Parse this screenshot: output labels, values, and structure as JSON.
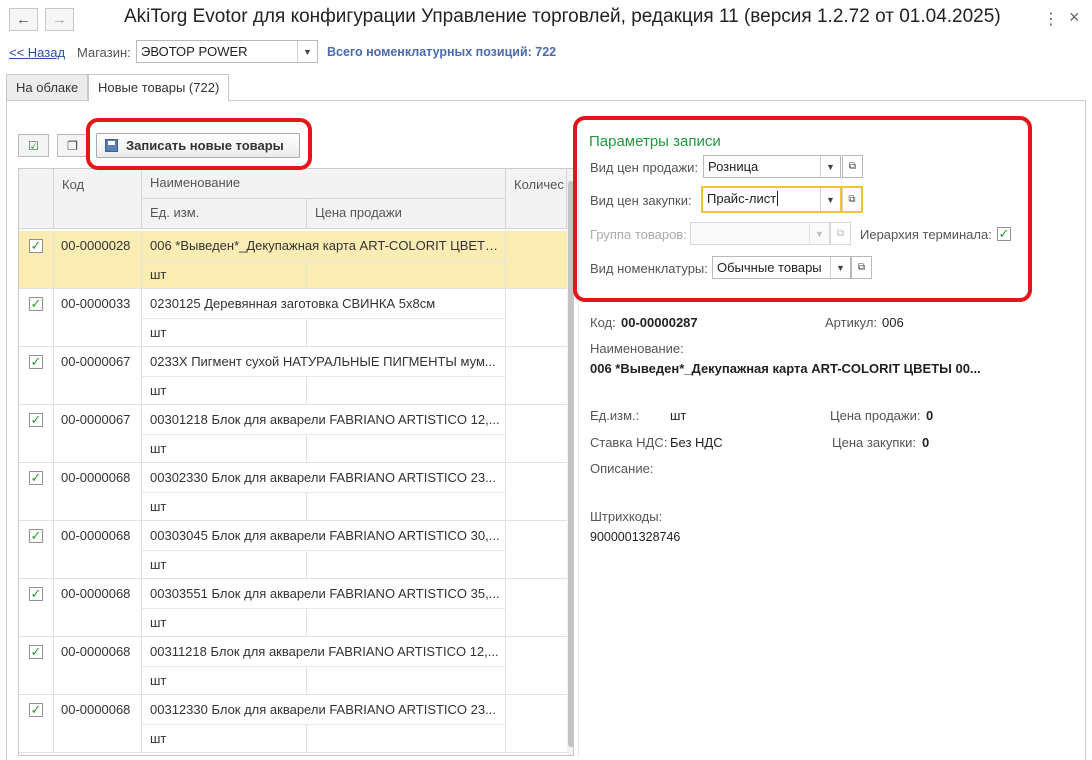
{
  "window": {
    "title": "AkiTorg Evotor для конфигурации Управление торговлей, редакция 11 (версия 1.2.72 от 01.04.2025)",
    "back_icon": "←",
    "forward_icon": "→",
    "menu_icon": "⋮",
    "close_icon": "×"
  },
  "topbar": {
    "back_link": "<< Назад",
    "store_label": "Магазин:",
    "store_value": "ЭВОТОР POWER",
    "total_text": "Всего номенклатурных позиций: 722"
  },
  "tabs": [
    {
      "label": "На облаке"
    },
    {
      "label": "Новые товары (722)"
    }
  ],
  "toolbar": {
    "save_new_label": "Записать новые товары"
  },
  "grid": {
    "columns": {
      "code": "Код",
      "name": "Наименование",
      "unit": "Ед. изм.",
      "price": "Цена продажи",
      "qty": "Количес"
    },
    "rows": [
      {
        "checked": "✓",
        "code": "00-0000028",
        "name": "006 *Выведен*_Декупажная карта ART-COLORIT ЦВЕТЫ 00...",
        "unit": "шт"
      },
      {
        "checked": "✓",
        "code": "00-0000033",
        "name": "0230125 Деревянная заготовка СВИНКА 5х8см",
        "unit": "шт"
      },
      {
        "checked": "✓",
        "code": "00-0000067",
        "name": "0233Х Пигмент сухой НАТУРАЛЬНЫЕ ПИГМЕНТЫ мум...",
        "unit": "шт"
      },
      {
        "checked": "✓",
        "code": "00-0000067",
        "name": "00301218 Блок для акварели FABRIANO ARTISTICO 12,...",
        "unit": "шт"
      },
      {
        "checked": "✓",
        "code": "00-0000068",
        "name": "00302330 Блок для акварели FABRIANO ARTISTICO 23...",
        "unit": "шт"
      },
      {
        "checked": "✓",
        "code": "00-0000068",
        "name": "00303045 Блок для акварели FABRIANO ARTISTICO 30,...",
        "unit": "шт"
      },
      {
        "checked": "✓",
        "code": "00-0000068",
        "name": "00303551 Блок для акварели FABRIANO ARTISTICO 35,...",
        "unit": "шт"
      },
      {
        "checked": "✓",
        "code": "00-0000068",
        "name": "00311218 Блок для акварели FABRIANO ARTISTICO 12,...",
        "unit": "шт"
      },
      {
        "checked": "✓",
        "code": "00-0000068",
        "name": "00312330 Блок для акварели FABRIANO ARTISTICO 23...",
        "unit": "шт"
      }
    ]
  },
  "params": {
    "title": "Параметры записи",
    "sale_price_label": "Вид цен продажи:",
    "sale_price_value": "Розница",
    "purchase_price_label": "Вид цен закупки:",
    "purchase_price_value": "Прайс-лист",
    "group_label": "Группа товаров:",
    "group_value": "",
    "hierarchy_label": "Иерархия терминала:",
    "hierarchy_checked": "✓",
    "nomenclature_label": "Вид номенклатуры:",
    "nomenclature_value": "Обычные товары"
  },
  "details": {
    "code_label": "Код:",
    "code_value": "00-00000287",
    "article_label": "Артикул:",
    "article_value": "006",
    "name_label": "Наименование:",
    "name_value": "006 *Выведен*_Декупажная карта ART-COLORIT ЦВЕТЫ 00...",
    "unit_label": "Ед.изм.:",
    "unit_value": "шт",
    "sale_price_label": "Цена продажи:",
    "sale_price_value": "0",
    "vat_label": "Ставка НДС:",
    "vat_value": "Без НДС",
    "purchase_price_label": "Цена закупки:",
    "purchase_price_value": "0",
    "description_label": "Описание:",
    "barcodes_label": "Штрихкоды:",
    "barcode_value": "9000001328746"
  }
}
